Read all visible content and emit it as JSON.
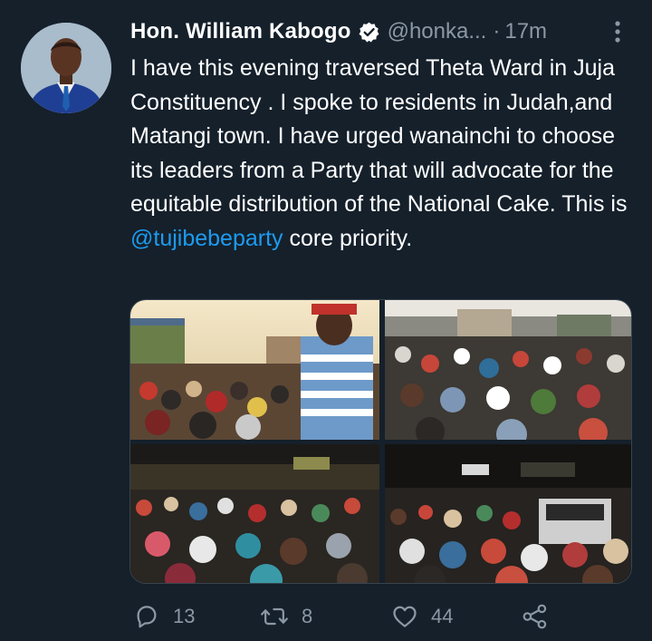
{
  "tweet": {
    "display_name": "Hon. William Kabogo",
    "handle": "@honka...",
    "separator": "·",
    "timestamp": "17m",
    "verified": true,
    "text_before_mention": "I have this evening traversed Theta Ward in Juja Constituency . I spoke to residents in Judah,and Matangi town. I have urged wanainchi to choose its leaders from a Party that will advocate for the equitable distribution of the National Cake. This is ",
    "mention": "@tujibebeparty",
    "text_after_mention": " core priority.",
    "media_count": 4
  },
  "actions": {
    "reply_count": "13",
    "retweet_count": "8",
    "like_count": "44"
  },
  "icons": {
    "verified": "verified-badge-icon",
    "more": "more-options-icon",
    "reply": "reply-icon",
    "retweet": "retweet-icon",
    "like": "heart-icon",
    "share": "share-icon"
  },
  "colors": {
    "background": "#15202b",
    "text": "#ffffff",
    "secondary": "#8b98a5",
    "link": "#1d9bf0"
  }
}
